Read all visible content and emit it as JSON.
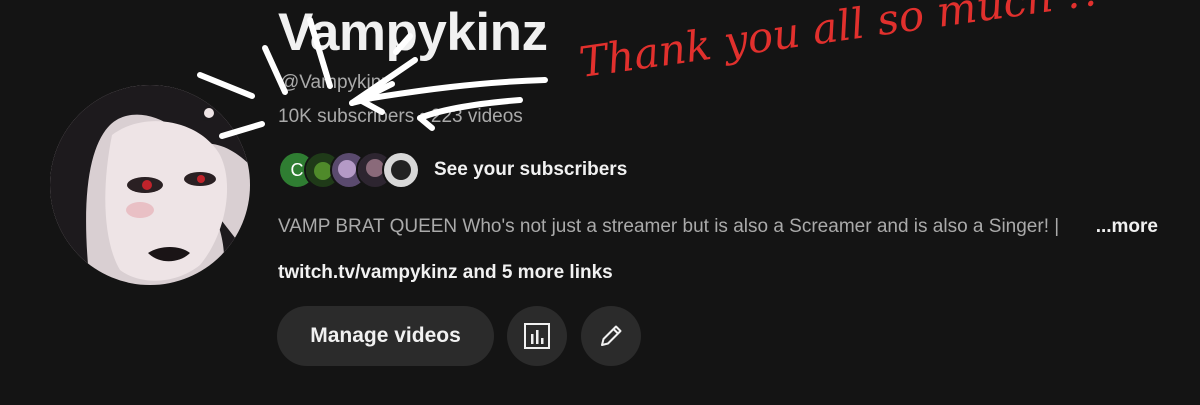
{
  "channel": {
    "name": "Vampykinz",
    "handle": "@Vampykinz",
    "subscribers": "10K subscribers",
    "separator": "•",
    "videos": "223 videos",
    "subscriber_avatar_initial": "C",
    "see_subscribers": "See your subscribers",
    "description": "VAMP BRAT QUEEN Who's not just a streamer but is also a Screamer and is also a Singer! |",
    "more_label": "...more",
    "link_url": "twitch.tv/vampykinz",
    "link_more": " and 5 more links"
  },
  "actions": {
    "manage_videos": "Manage videos",
    "analytics_icon": "bar-chart-icon",
    "edit_icon": "pencil-icon"
  },
  "annotation": {
    "handwritten_note": "Thank you all so much !!",
    "note_color": "#e1302d"
  },
  "colors": {
    "background": "#141414",
    "primary_text": "#f1f1f1",
    "secondary_text": "#aaaaaa",
    "button_bg": "#2b2b2b"
  }
}
